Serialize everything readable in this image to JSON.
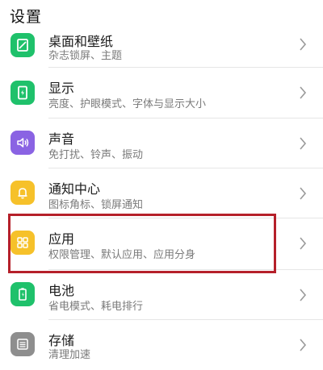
{
  "header": {
    "title": "设置"
  },
  "items": [
    {
      "key": "desktop",
      "title": "桌面和壁纸",
      "subtitle": "杂志锁屏、主题",
      "icon": "wallpaper-icon",
      "color": "#1fc16b"
    },
    {
      "key": "display",
      "title": "显示",
      "subtitle": "亮度、护眼模式、字体与显示大小",
      "icon": "display-icon",
      "color": "#1fc16b"
    },
    {
      "key": "sound",
      "title": "声音",
      "subtitle": "免打扰、铃声、振动",
      "icon": "speaker-icon",
      "color": "#8a63e3"
    },
    {
      "key": "notifications",
      "title": "通知中心",
      "subtitle": "图标角标、锁屏通知",
      "icon": "bell-icon",
      "color": "#f6c12a"
    },
    {
      "key": "apps",
      "title": "应用",
      "subtitle": "权限管理、默认应用、应用分身",
      "icon": "apps-grid-icon",
      "color": "#f6c12a"
    },
    {
      "key": "battery",
      "title": "电池",
      "subtitle": "省电模式、耗电排行",
      "icon": "battery-icon",
      "color": "#1fc16b"
    },
    {
      "key": "storage",
      "title": "存储",
      "subtitle": "清理加速",
      "icon": "storage-icon",
      "color": "#8e8e8e"
    }
  ],
  "highlight_color": "#b5202a"
}
